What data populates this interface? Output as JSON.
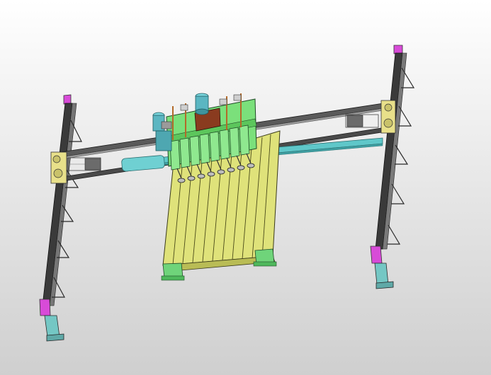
{
  "viewport": {
    "background_top": "#ffffff",
    "background_bottom": "#cfcfcf"
  },
  "model": {
    "visible_parts": [
      "left-post",
      "right-post",
      "horizontal-beam",
      "carriage-assembly",
      "suction-cup-array",
      "panel-stack",
      "base-feet",
      "motors"
    ],
    "suction_cup_count": 8,
    "panel_slat_count": 11,
    "colors": {
      "post_dark": "#3a3a3a",
      "beam_rail": "#5fc7c9",
      "beam_dark": "#4a4a4a",
      "carriage_green": "#7be07b",
      "panel_yellow": "#dfe27a",
      "motor_teal": "#5bb6c2",
      "accent_magenta": "#d84bd8",
      "housing_brown": "#8a3b1f",
      "foot_green": "#6fd47a",
      "foot_teal": "#74c7c4"
    }
  }
}
